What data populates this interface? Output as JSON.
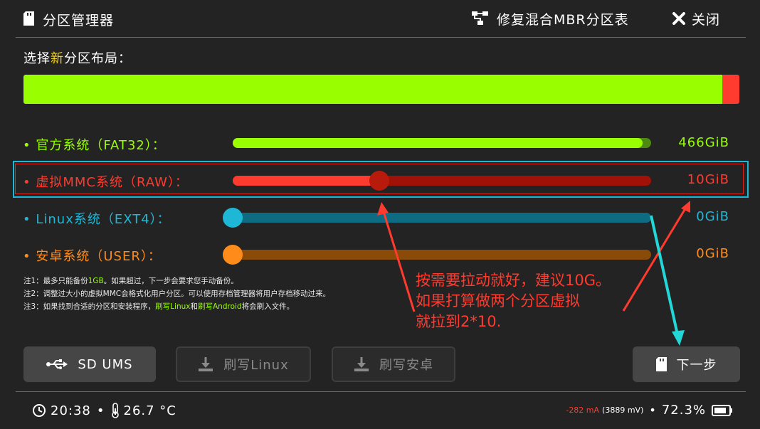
{
  "header": {
    "title": "分区管理器",
    "mbr_label": "修复混合MBR分区表",
    "close_label": "关闭"
  },
  "layout": {
    "prefix": "选择",
    "highlight": "新",
    "suffix": "分区布局："
  },
  "partitions": [
    {
      "label": "官方系统（FAT32）：",
      "size": "466GiB",
      "fill_fraction": 1.0,
      "color": "#99ff00",
      "track_color": "#4e8a12",
      "has_knob": false
    },
    {
      "label": "虚拟MMC系统（RAW）：",
      "size": "10GiB",
      "fill_fraction": 0.35,
      "color": "#ff3a2e",
      "track_color": "#a01208",
      "has_knob": true,
      "knob_color": "#b81a0c"
    },
    {
      "label": "Linux系统（EXT4）：",
      "size": "0GiB",
      "fill_fraction": 0,
      "color": "#1fb7d6",
      "track_color": "#0e6c82",
      "has_knob": true,
      "knob_color": "#1fb7d6"
    },
    {
      "label": "安卓系统（USER）：",
      "size": "0GiB",
      "fill_fraction": 0,
      "color": "#ff8c1a",
      "track_color": "#8a4a08",
      "has_knob": true,
      "knob_color": "#ff8c1a"
    }
  ],
  "notes": {
    "n1": {
      "a": "注1：最多只能备份",
      "b": "1GB",
      "c": "。如果超过，下一步会要求您手动备份。"
    },
    "n2": "注2：调整过大小的虚拟MMC会格式化用户分区。可以使用存档管理器将用户存档移动过来。",
    "n3": {
      "a": "注3：如果找到合适的分区和安装程序，",
      "b": "刷写Linux",
      "c": "和",
      "d": "刷写Android",
      "e": "将会刷入文件。"
    }
  },
  "buttons": {
    "ums": "SD UMS",
    "flash_linux": "刷写Linux",
    "flash_android": "刷写安卓",
    "next": "下一步"
  },
  "status": {
    "time": "20:38",
    "temp": "26.7 °C",
    "current": "-282 mA",
    "voltage": "(3889 mV)",
    "battery": "72.3%"
  },
  "annotation": {
    "line1": "按需要拉动就好，建议10G。",
    "line2": "如果打算做两个分区虚拟",
    "line3": "就拉到2*10."
  },
  "colors": {
    "green": "#99ff00",
    "red": "#ff3a2e",
    "cyan": "#1fb7d6",
    "orange": "#ff8c1a",
    "highlight": "#f5d31a"
  }
}
